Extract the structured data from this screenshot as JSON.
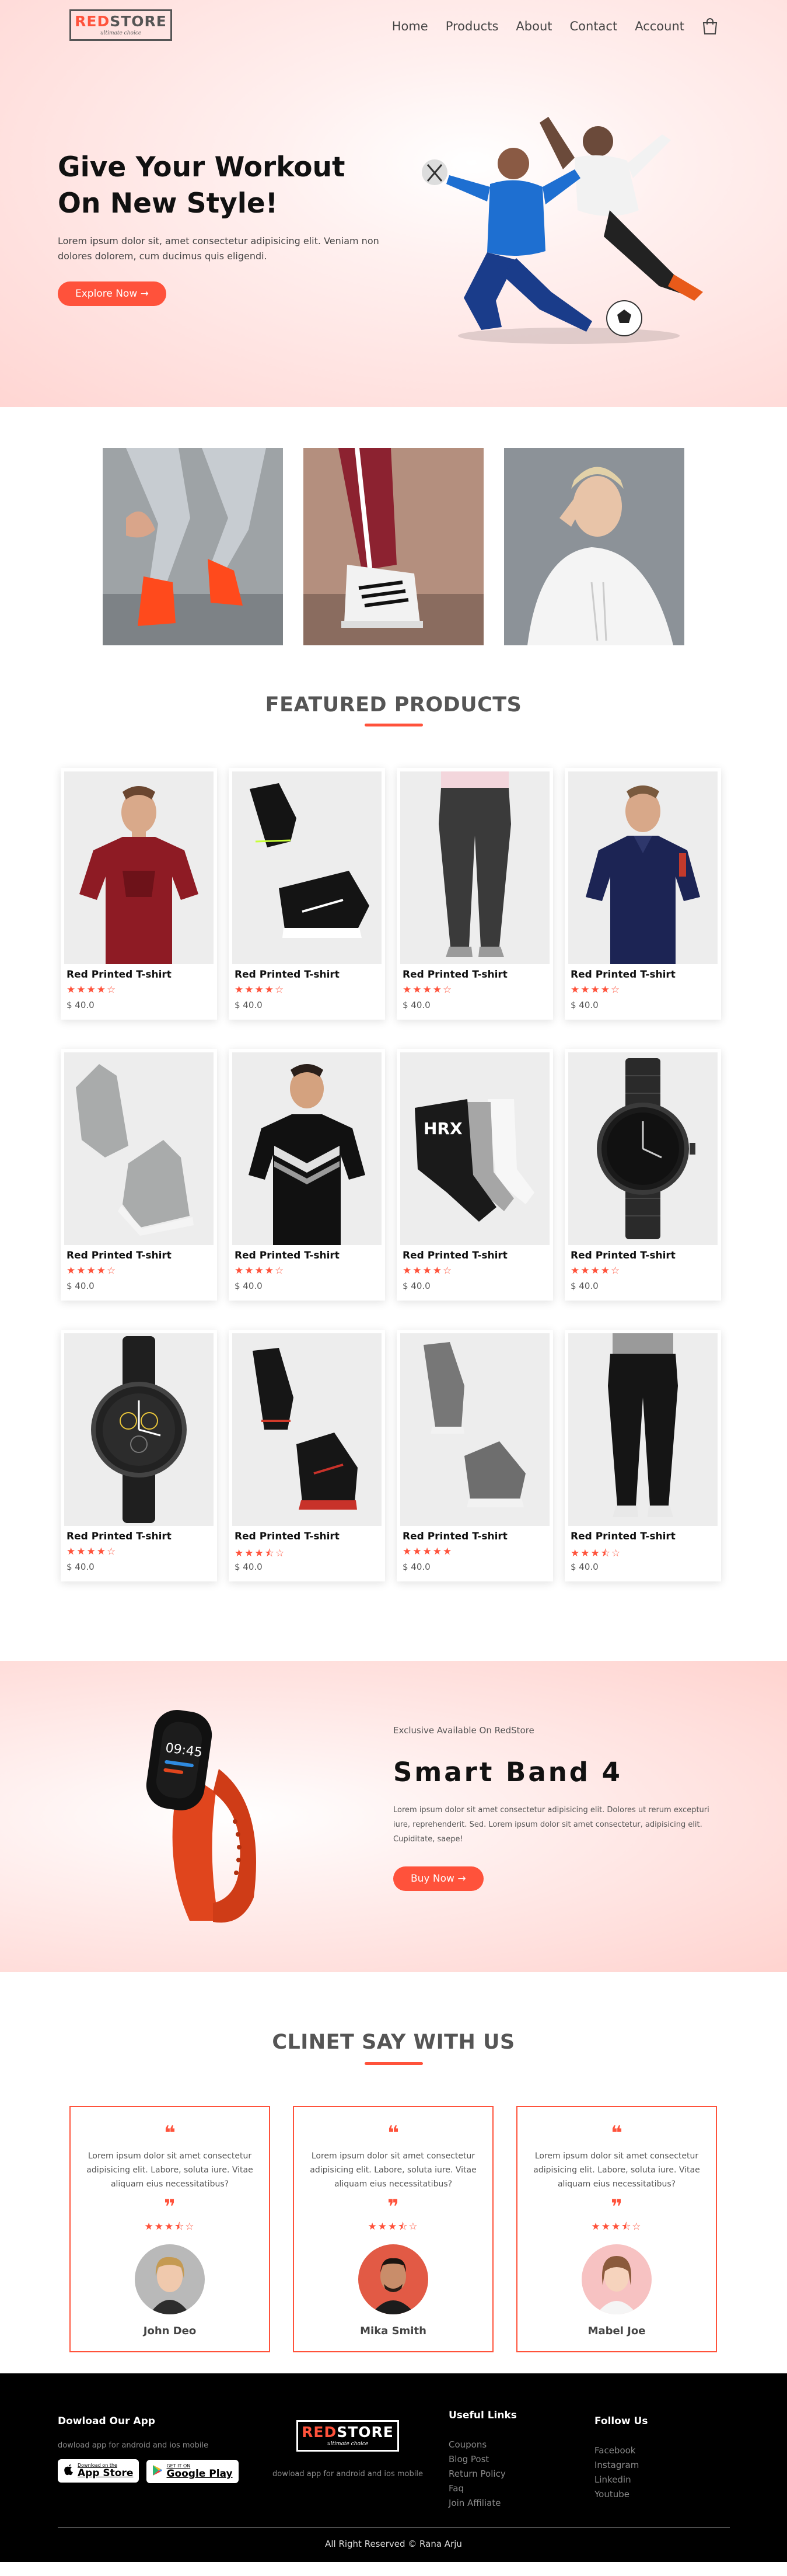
{
  "brand": {
    "name_red": "RED",
    "name_rest": "STORE",
    "tagline": "ultimate choice"
  },
  "nav": {
    "items": [
      "Home",
      "Products",
      "About",
      "Contact",
      "Account"
    ]
  },
  "hero": {
    "title_line1": "Give Your Workout",
    "title_line2": "On New Style!",
    "subtitle": "Lorem ipsum dolor sit, amet consectetur adipisicing elit. Veniam non dolores dolorem, cum ducimus quis eligendi.",
    "button": "Explore Now →"
  },
  "featured": {
    "title": "FEATURED PRODUCTS",
    "products": [
      {
        "name": "Red Printed T-shirt",
        "stars": "★★★★☆",
        "price": "$ 40.0",
        "image": "maroon-tshirt"
      },
      {
        "name": "Red Printed T-shirt",
        "stars": "★★★★☆",
        "price": "$ 40.0",
        "image": "black-sneakers"
      },
      {
        "name": "Red Printed T-shirt",
        "stars": "★★★★☆",
        "price": "$ 40.0",
        "image": "grey-joggers"
      },
      {
        "name": "Red Printed T-shirt",
        "stars": "★★★★☆",
        "price": "$ 40.0",
        "image": "navy-polo"
      },
      {
        "name": "Red Printed T-shirt",
        "stars": "★★★★☆",
        "price": "$ 40.0",
        "image": "grey-high-top-sneakers"
      },
      {
        "name": "Red Printed T-shirt",
        "stars": "★★★★☆",
        "price": "$ 40.0",
        "image": "black-chevron-tshirt"
      },
      {
        "name": "Red Printed T-shirt",
        "stars": "★★★★☆",
        "price": "$ 40.0",
        "image": "socks-pack"
      },
      {
        "name": "Red Printed T-shirt",
        "stars": "★★★★☆",
        "price": "$ 40.0",
        "image": "black-steel-watch"
      },
      {
        "name": "Red Printed T-shirt",
        "stars": "★★★★☆",
        "price": "$ 40.0",
        "image": "black-leather-watch"
      },
      {
        "name": "Red Printed T-shirt",
        "stars": "★★★⯪☆",
        "price": "$ 40.0",
        "image": "black-red-sneakers"
      },
      {
        "name": "Red Printed T-shirt",
        "stars": "★★★★★",
        "price": "$ 40.0",
        "image": "grey-running-shoes"
      },
      {
        "name": "Red Printed T-shirt",
        "stars": "★★★⯪☆",
        "price": "$ 40.0",
        "image": "black-track-pants"
      }
    ]
  },
  "offer": {
    "small": "Exclusive Available On RedStore",
    "title": "Smart Band 4",
    "desc": "Lorem ipsum dolor sit amet consectetur adipisicing elit. Dolores ut rerum excepturi iure, reprehenderit. Sed. Lorem ipsum dolor sit amet consectetur, adipisicing elit. Cupiditate, saepe!",
    "button": "Buy Now →",
    "band_time": "09:45"
  },
  "testimonials": {
    "title": "CLINET SAY WITH US",
    "items": [
      {
        "quote_open": "❝",
        "text": "Lorem ipsum dolor sit amet consectetur adipisicing elit. Labore, soluta iure. Vitae aliquam eius necessitatibus?",
        "quote_close": "❞",
        "stars": "★★★⯪☆",
        "name": "John Deo"
      },
      {
        "quote_open": "❝",
        "text": "Lorem ipsum dolor sit amet consectetur adipisicing elit. Labore, soluta iure. Vitae aliquam eius necessitatibus?",
        "quote_close": "❞",
        "stars": "★★★⯪☆",
        "name": "Mika Smith"
      },
      {
        "quote_open": "❝",
        "text": "Lorem ipsum dolor sit amet consectetur adipisicing elit. Labore, soluta iure. Vitae aliquam eius necessitatibus?",
        "quote_close": "❞",
        "stars": "★★★⯪☆",
        "name": "Mabel Joe"
      }
    ]
  },
  "footer": {
    "app_title": "Dowload Our App",
    "app_sub": "dowload app for android and ios mobile",
    "appstore_small": "Download on the",
    "appstore_big": "App Store",
    "googleplay_small": "GET IT ON",
    "googleplay_big": "Google Play",
    "logo_sub": "dowload app for android and ios mobile",
    "useful_title": "Useful Links",
    "useful_links": [
      "Coupons",
      "Blog Post",
      "Return Policy",
      "Faq",
      "Join Affiliate"
    ],
    "follow_title": "Follow Us",
    "follow_links": [
      "Facebook",
      "Instagram",
      "Linkedin",
      "Youtube"
    ],
    "copyright": "All Right Reserved © Rana Arju"
  },
  "colors": {
    "accent": "#ff523b",
    "hero_bg": "#ffd6d3",
    "footer_bg": "#000000"
  }
}
